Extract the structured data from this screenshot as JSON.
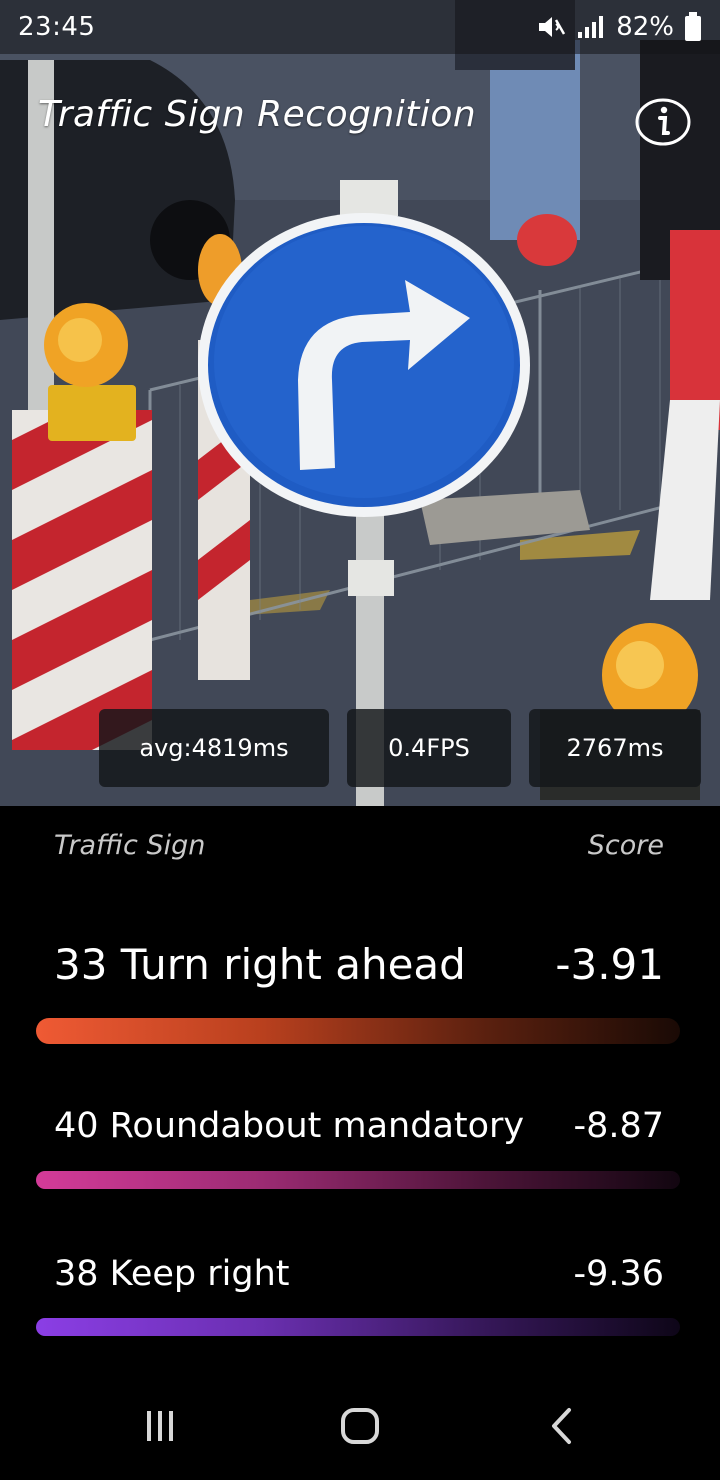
{
  "status_bar": {
    "time": "23:45",
    "battery_percent": "82%",
    "icons": [
      "mute-icon",
      "signal-icon",
      "battery-icon"
    ]
  },
  "app": {
    "title": "Traffic Sign Recognition",
    "info_icon": "info-icon"
  },
  "timing": {
    "average": "avg:4819ms",
    "fps": "0.4FPS",
    "current": "2767ms"
  },
  "results": {
    "column_sign": "Traffic Sign",
    "column_score": "Score",
    "items": [
      {
        "label": "33 Turn right ahead",
        "score": "-3.91",
        "color": "#ef5a34"
      },
      {
        "label": "40  Roundabout mandatory",
        "score": "-8.87",
        "color": "#d43b99"
      },
      {
        "label": "38  Keep right",
        "score": "-9.36",
        "color": "#8b3ee5"
      }
    ]
  },
  "navigation": {
    "icons": [
      "recent-apps-icon",
      "home-icon",
      "back-icon"
    ]
  }
}
